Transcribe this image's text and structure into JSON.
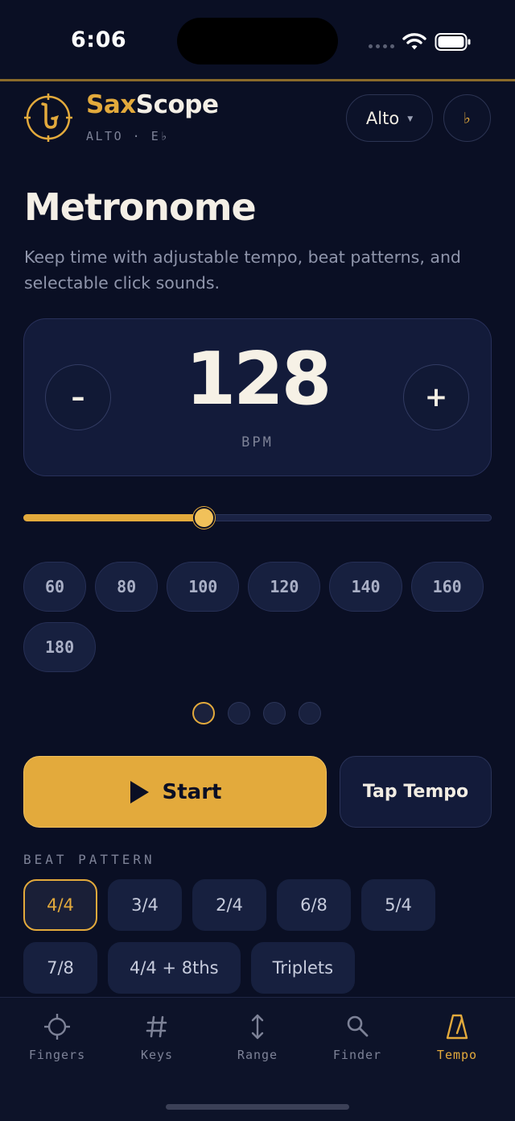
{
  "status_bar": {
    "time": "6:06"
  },
  "header": {
    "brand_part1": "Sax",
    "brand_part2": "Scope",
    "subtitle": "ALTO · E♭",
    "instrument": "Alto",
    "accidental": "♭"
  },
  "page": {
    "title": "Metronome",
    "description": "Keep time with adjustable tempo, beat patterns, and selectable click sounds."
  },
  "tempo": {
    "minus_label": "–",
    "plus_label": "+",
    "bpm": "128",
    "unit": "BPM",
    "slider_fraction": 0.386,
    "presets": [
      "60",
      "80",
      "100",
      "120",
      "140",
      "160",
      "180"
    ]
  },
  "beats": {
    "count": 4,
    "active_index": 0
  },
  "actions": {
    "start_label": "Start",
    "tap_label": "Tap Tempo"
  },
  "beat_pattern": {
    "label": "BEAT PATTERN",
    "options": [
      "4/4",
      "3/4",
      "2/4",
      "6/8",
      "5/4",
      "7/8",
      "4/4 + 8ths",
      "Triplets"
    ],
    "selected_index": 0
  },
  "tabs": [
    {
      "label": "Fingers",
      "icon": "crosshair-icon"
    },
    {
      "label": "Keys",
      "icon": "hash-icon"
    },
    {
      "label": "Range",
      "icon": "up-down-arrow-icon"
    },
    {
      "label": "Finder",
      "icon": "search-icon"
    },
    {
      "label": "Tempo",
      "icon": "metronome-icon"
    }
  ],
  "active_tab_index": 4,
  "colors": {
    "accent": "#e3aa3c",
    "background": "#0a0f24",
    "card": "#131b3a"
  }
}
